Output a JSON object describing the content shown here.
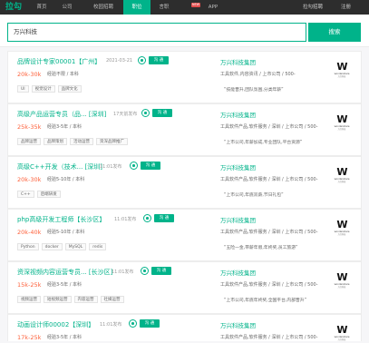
{
  "nav": {
    "logo": "拉勾",
    "items": [
      "首页",
      "公司",
      "校园招聘",
      "职位",
      "言职",
      "",
      "APP"
    ],
    "badge": "NEW",
    "right": [
      "拉勾招聘",
      "注册"
    ]
  },
  "search": {
    "value": "万兴科技",
    "button": "搜索"
  },
  "jobs": [
    {
      "title": "品牌设计专家00001【广州】",
      "date": "2021-03-21",
      "chat": "沟  通",
      "salary": "20k-30k",
      "req": "经验不限 / 本科",
      "tags": [
        "UI",
        "视觉设计",
        "品牌文化"
      ],
      "company": "万兴科技集团",
      "industry": "工具软件,内容资讯 / 上市公司 / 500-",
      "benefit": "“技能晋升,团队氛围,分类年薪”"
    },
    {
      "title": "高级产品运营专员（品... [深圳]",
      "date": "17天前发布",
      "chat": "沟  通",
      "salary": "25k-35k",
      "req": "经验3-5年 / 本科",
      "tags": [
        "品牌运营",
        "品牌策划",
        "活动运营",
        "资深品牌推广"
      ],
      "company": "万兴科技集团",
      "industry": "工具软件产品,软件服务 / 深圳 / 上市公司 / 500-",
      "benefit": "“上市公司,年薪加成,专业团队,平台资源”"
    },
    {
      "title": "高级C++开发（技术... [深圳]",
      "date": "11:01发布",
      "chat": "沟  通",
      "salary": "20k-30k",
      "req": "经验5-10年 / 本科",
      "tags": [
        "C++",
        "后端研发"
      ],
      "company": "万兴科技集团",
      "industry": "工具软件产品,软件服务 / 深圳 / 上市公司 / 500-",
      "benefit": "“上市公司,年底双薪,节日礼包”"
    },
    {
      "title": "php高级开发工程师【长沙区】",
      "date": "11:01发布",
      "chat": "沟  通",
      "salary": "20k-40k",
      "req": "经验5-10年 / 本科",
      "tags": [
        "Python",
        "docker",
        "MySQL",
        "redis"
      ],
      "company": "万兴科技集团",
      "industry": "工具软件产品,软件服务 / 深圳 / 上市公司 / 500-",
      "benefit": "“五险一金,带薪年假,年终奖,员工旅游”"
    },
    {
      "title": "资深视频内容运营专员... [长沙区]",
      "date": "11:01发布",
      "chat": "沟  通",
      "salary": "15k-25k",
      "req": "经验3-5年 / 本科",
      "tags": [
        "视频运营",
        "短视频运营",
        "内容运营",
        "社媒运营"
      ],
      "company": "万兴科技集团",
      "industry": "工具软件产品,软件服务 / 深圳 / 上市公司 / 500-",
      "benefit": "“上市公司,年底年终奖,全国平台,内部晋升”"
    },
    {
      "title": "动画设计师00002【深圳】",
      "date": "11:01发布",
      "chat": "沟  通",
      "salary": "17k-25k",
      "req": "经验3-5年 / 本科",
      "tags": [],
      "company": "万兴科技集团",
      "industry": "工具软件产品,软件服务 / 深圳 / 上市公司 / 500-",
      "benefit": ""
    }
  ],
  "company_logo": {
    "mark": "W",
    "text": "wondershare",
    "sub": "万兴科技"
  },
  "colors": {
    "brand": "#00b38a",
    "salary": "#fd5f39",
    "nav_bg": "#2d2d2d"
  }
}
